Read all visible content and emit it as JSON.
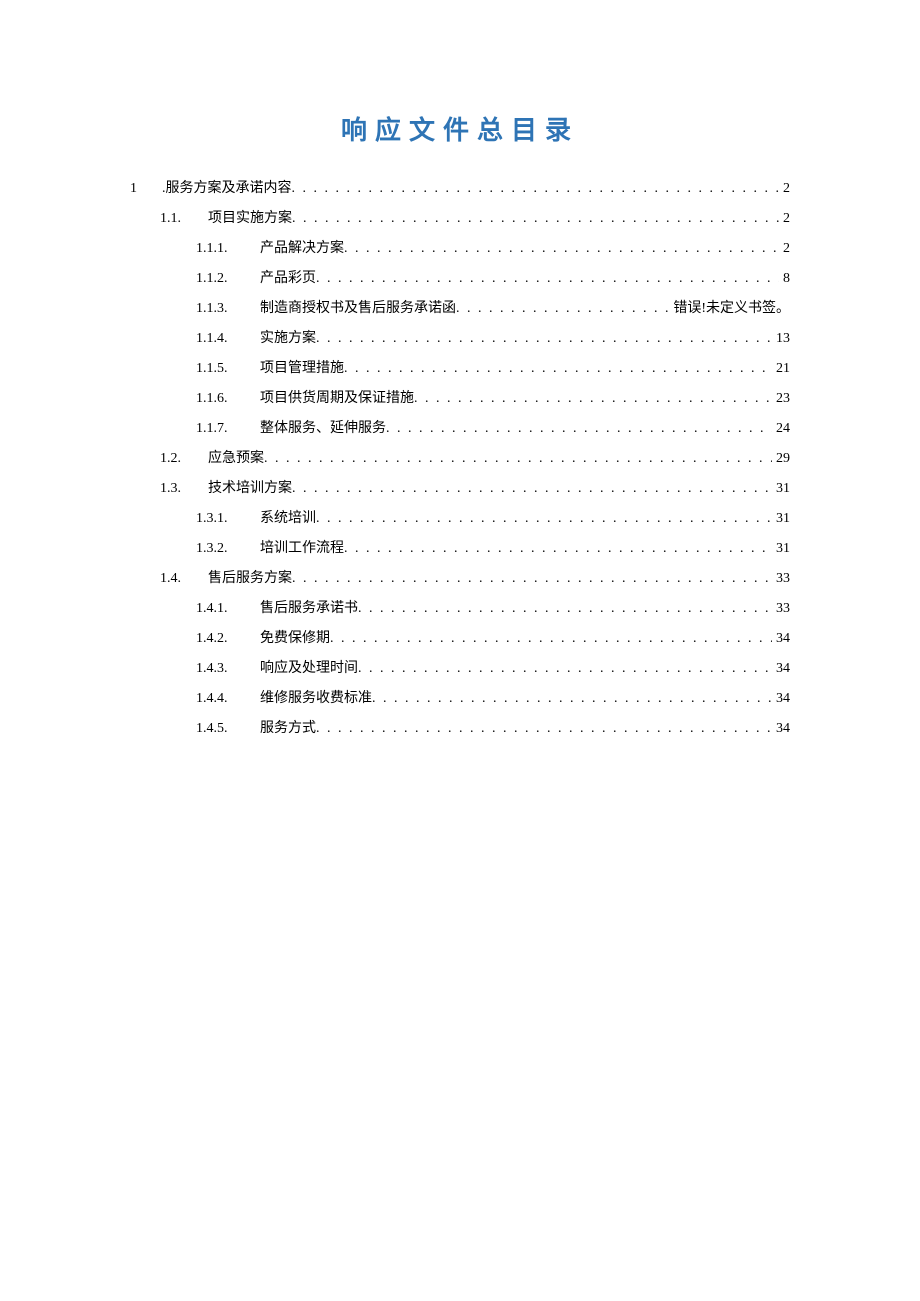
{
  "title": "响应文件总目录",
  "toc": [
    {
      "level": 1,
      "num": "1",
      "label": ".服务方案及承诺内容",
      "page": "2"
    },
    {
      "level": 2,
      "num": "1.1.",
      "label": "项目实施方案",
      "page": "2"
    },
    {
      "level": 3,
      "num": "1.1.1.",
      "label": "产品解决方案",
      "page": "2"
    },
    {
      "level": 3,
      "num": "1.1.2.",
      "label": "产品彩页",
      "page": "8"
    },
    {
      "level": 3,
      "num": "1.1.3.",
      "label": "制造商授权书及售后服务承诺函",
      "page": "错误!未定义书签。"
    },
    {
      "level": 3,
      "num": "1.1.4.",
      "label": "实施方案",
      "page": "13"
    },
    {
      "level": 3,
      "num": "1.1.5.",
      "label": "项目管理措施",
      "page": "21"
    },
    {
      "level": 3,
      "num": "1.1.6.",
      "label": "项目供货周期及保证措施",
      "page": "23"
    },
    {
      "level": 3,
      "num": "1.1.7.",
      "label": "整体服务、延伸服务",
      "page": "24"
    },
    {
      "level": 2,
      "num": "1.2.",
      "label": "应急预案",
      "page": "29"
    },
    {
      "level": 2,
      "num": "1.3.",
      "label": "技术培训方案",
      "page": "31"
    },
    {
      "level": 3,
      "num": "1.3.1.",
      "label": "系统培训",
      "page": "31"
    },
    {
      "level": 3,
      "num": "1.3.2.",
      "label": "培训工作流程",
      "page": "31"
    },
    {
      "level": 2,
      "num": "1.4.",
      "label": "售后服务方案",
      "page": "33"
    },
    {
      "level": 3,
      "num": "1.4.1.",
      "label": "售后服务承诺书",
      "page": "33"
    },
    {
      "level": 3,
      "num": "1.4.2.",
      "label": "免费保修期",
      "page": "34"
    },
    {
      "level": 3,
      "num": "1.4.3.",
      "label": "响应及处理时间",
      "page": "34"
    },
    {
      "level": 3,
      "num": "1.4.4.",
      "label": "维修服务收费标准",
      "page": "34"
    },
    {
      "level": 3,
      "num": "1.4.5.",
      "label": "服务方式",
      "page": "34"
    }
  ]
}
